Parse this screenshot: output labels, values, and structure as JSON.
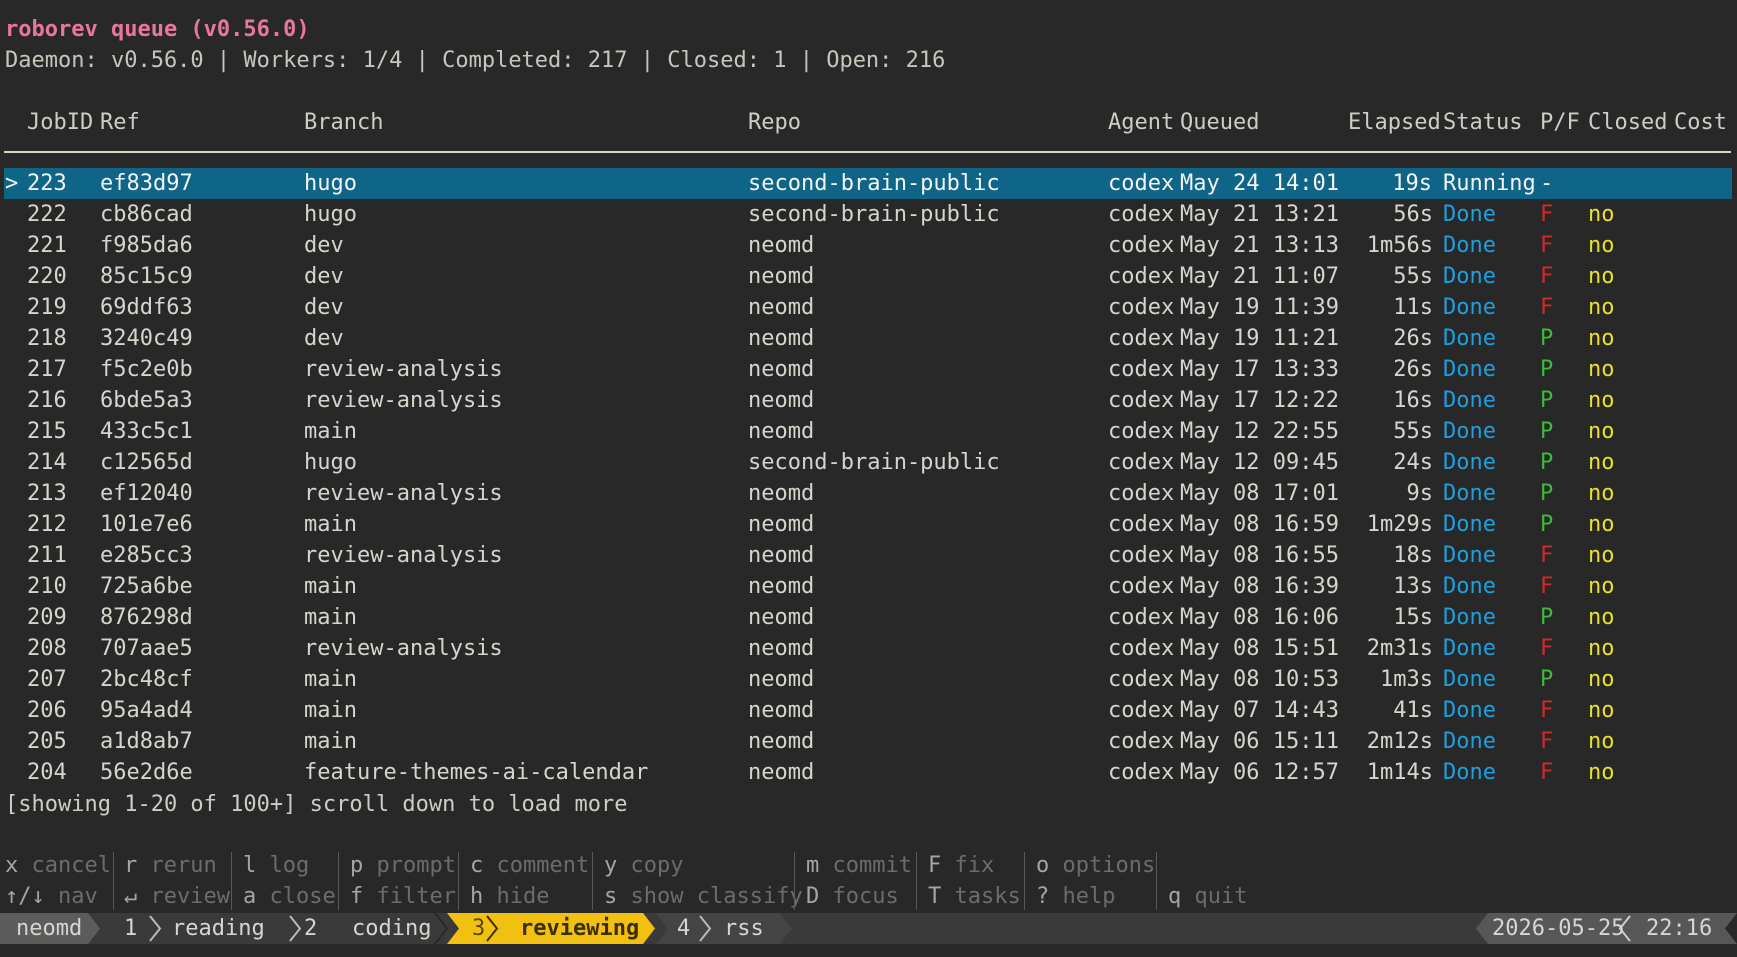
{
  "app": {
    "title": "roborev queue (v0.56.0)",
    "status_line": "Daemon: v0.56.0 | Workers: 1/4 | Completed: 217 | Closed: 1 | Open: 216"
  },
  "table": {
    "columns": {
      "jobid": "JobID",
      "ref": "Ref",
      "branch": "Branch",
      "repo": "Repo",
      "agent": "Agent",
      "queued": "Queued",
      "elapsed": "Elapsed",
      "status": "Status",
      "pf": "P/F",
      "closed": "Closed",
      "cost": "Cost"
    },
    "selection_marker": ">",
    "rows": [
      {
        "jobid": "223",
        "ref": "ef83d97",
        "branch": "hugo",
        "repo": "second-brain-public",
        "agent": "codex",
        "queued": "May 24 14:01",
        "elapsed": "19s",
        "status": "Running",
        "pf": "-",
        "closed": "",
        "selected": true
      },
      {
        "jobid": "222",
        "ref": "cb86cad",
        "branch": "hugo",
        "repo": "second-brain-public",
        "agent": "codex",
        "queued": "May 21 13:21",
        "elapsed": "56s",
        "status": "Done",
        "pf": "F",
        "closed": "no"
      },
      {
        "jobid": "221",
        "ref": "f985da6",
        "branch": "dev",
        "repo": "neomd",
        "agent": "codex",
        "queued": "May 21 13:13",
        "elapsed": "1m56s",
        "status": "Done",
        "pf": "F",
        "closed": "no"
      },
      {
        "jobid": "220",
        "ref": "85c15c9",
        "branch": "dev",
        "repo": "neomd",
        "agent": "codex",
        "queued": "May 21 11:07",
        "elapsed": "55s",
        "status": "Done",
        "pf": "F",
        "closed": "no"
      },
      {
        "jobid": "219",
        "ref": "69ddf63",
        "branch": "dev",
        "repo": "neomd",
        "agent": "codex",
        "queued": "May 19 11:39",
        "elapsed": "11s",
        "status": "Done",
        "pf": "F",
        "closed": "no"
      },
      {
        "jobid": "218",
        "ref": "3240c49",
        "branch": "dev",
        "repo": "neomd",
        "agent": "codex",
        "queued": "May 19 11:21",
        "elapsed": "26s",
        "status": "Done",
        "pf": "P",
        "closed": "no"
      },
      {
        "jobid": "217",
        "ref": "f5c2e0b",
        "branch": "review-analysis",
        "repo": "neomd",
        "agent": "codex",
        "queued": "May 17 13:33",
        "elapsed": "26s",
        "status": "Done",
        "pf": "P",
        "closed": "no"
      },
      {
        "jobid": "216",
        "ref": "6bde5a3",
        "branch": "review-analysis",
        "repo": "neomd",
        "agent": "codex",
        "queued": "May 17 12:22",
        "elapsed": "16s",
        "status": "Done",
        "pf": "P",
        "closed": "no"
      },
      {
        "jobid": "215",
        "ref": "433c5c1",
        "branch": "main",
        "repo": "neomd",
        "agent": "codex",
        "queued": "May 12 22:55",
        "elapsed": "55s",
        "status": "Done",
        "pf": "P",
        "closed": "no"
      },
      {
        "jobid": "214",
        "ref": "c12565d",
        "branch": "hugo",
        "repo": "second-brain-public",
        "agent": "codex",
        "queued": "May 12 09:45",
        "elapsed": "24s",
        "status": "Done",
        "pf": "P",
        "closed": "no"
      },
      {
        "jobid": "213",
        "ref": "ef12040",
        "branch": "review-analysis",
        "repo": "neomd",
        "agent": "codex",
        "queued": "May 08 17:01",
        "elapsed": "9s",
        "status": "Done",
        "pf": "P",
        "closed": "no"
      },
      {
        "jobid": "212",
        "ref": "101e7e6",
        "branch": "main",
        "repo": "neomd",
        "agent": "codex",
        "queued": "May 08 16:59",
        "elapsed": "1m29s",
        "status": "Done",
        "pf": "P",
        "closed": "no"
      },
      {
        "jobid": "211",
        "ref": "e285cc3",
        "branch": "review-analysis",
        "repo": "neomd",
        "agent": "codex",
        "queued": "May 08 16:55",
        "elapsed": "18s",
        "status": "Done",
        "pf": "F",
        "closed": "no"
      },
      {
        "jobid": "210",
        "ref": "725a6be",
        "branch": "main",
        "repo": "neomd",
        "agent": "codex",
        "queued": "May 08 16:39",
        "elapsed": "13s",
        "status": "Done",
        "pf": "F",
        "closed": "no"
      },
      {
        "jobid": "209",
        "ref": "876298d",
        "branch": "main",
        "repo": "neomd",
        "agent": "codex",
        "queued": "May 08 16:06",
        "elapsed": "15s",
        "status": "Done",
        "pf": "P",
        "closed": "no"
      },
      {
        "jobid": "208",
        "ref": "707aae5",
        "branch": "review-analysis",
        "repo": "neomd",
        "agent": "codex",
        "queued": "May 08 15:51",
        "elapsed": "2m31s",
        "status": "Done",
        "pf": "F",
        "closed": "no"
      },
      {
        "jobid": "207",
        "ref": "2bc48cf",
        "branch": "main",
        "repo": "neomd",
        "agent": "codex",
        "queued": "May 08 10:53",
        "elapsed": "1m3s",
        "status": "Done",
        "pf": "P",
        "closed": "no"
      },
      {
        "jobid": "206",
        "ref": "95a4ad4",
        "branch": "main",
        "repo": "neomd",
        "agent": "codex",
        "queued": "May 07 14:43",
        "elapsed": "41s",
        "status": "Done",
        "pf": "F",
        "closed": "no"
      },
      {
        "jobid": "205",
        "ref": "a1d8ab7",
        "branch": "main",
        "repo": "neomd",
        "agent": "codex",
        "queued": "May 06 15:11",
        "elapsed": "2m12s",
        "status": "Done",
        "pf": "F",
        "closed": "no"
      },
      {
        "jobid": "204",
        "ref": "56e2d6e",
        "branch": "feature-themes-ai-calendar",
        "repo": "neomd",
        "agent": "codex",
        "queued": "May 06 12:57",
        "elapsed": "1m14s",
        "status": "Done",
        "pf": "F",
        "closed": "no"
      }
    ],
    "footer_message": "[showing 1-20 of 100+] scroll down to load more"
  },
  "hints": {
    "row1": [
      {
        "key": "x",
        "desc": "cancel"
      },
      {
        "key": "r",
        "desc": "rerun"
      },
      {
        "key": "l",
        "desc": "log"
      },
      {
        "key": "p",
        "desc": "prompt"
      },
      {
        "key": "c",
        "desc": "comment"
      },
      {
        "key": "y",
        "desc": "copy"
      },
      {
        "key": "m",
        "desc": "commit"
      },
      {
        "key": "F",
        "desc": "fix"
      },
      {
        "key": "o",
        "desc": "options"
      }
    ],
    "row2": [
      {
        "key": "↑/↓",
        "desc": "nav"
      },
      {
        "key": "↵",
        "desc": "review"
      },
      {
        "key": "a",
        "desc": "close"
      },
      {
        "key": "f",
        "desc": "filter"
      },
      {
        "key": "h",
        "desc": "hide"
      },
      {
        "key": "s",
        "desc": "show classify"
      },
      {
        "key": "D",
        "desc": "focus"
      },
      {
        "key": "T",
        "desc": "tasks"
      },
      {
        "key": "?",
        "desc": "help"
      },
      {
        "key": "q",
        "desc": "quit"
      }
    ]
  },
  "tabbar": {
    "session": "neomd",
    "tabs": [
      {
        "index": "1",
        "name": "reading"
      },
      {
        "index": "2",
        "name": "coding"
      },
      {
        "index": "3",
        "name": "reviewing",
        "active": true
      },
      {
        "index": "4",
        "name": "rss"
      }
    ],
    "date": "2026-05-25",
    "time": "22:16"
  },
  "colors": {
    "background": "#282828",
    "title": "#e8779a",
    "selection": "#0f6587",
    "status_done": "#1e9fe0",
    "fail": "#d22a2a",
    "pass": "#3dbb3a",
    "closed_no": "#e8e029",
    "active_tab": "#f2c010"
  }
}
